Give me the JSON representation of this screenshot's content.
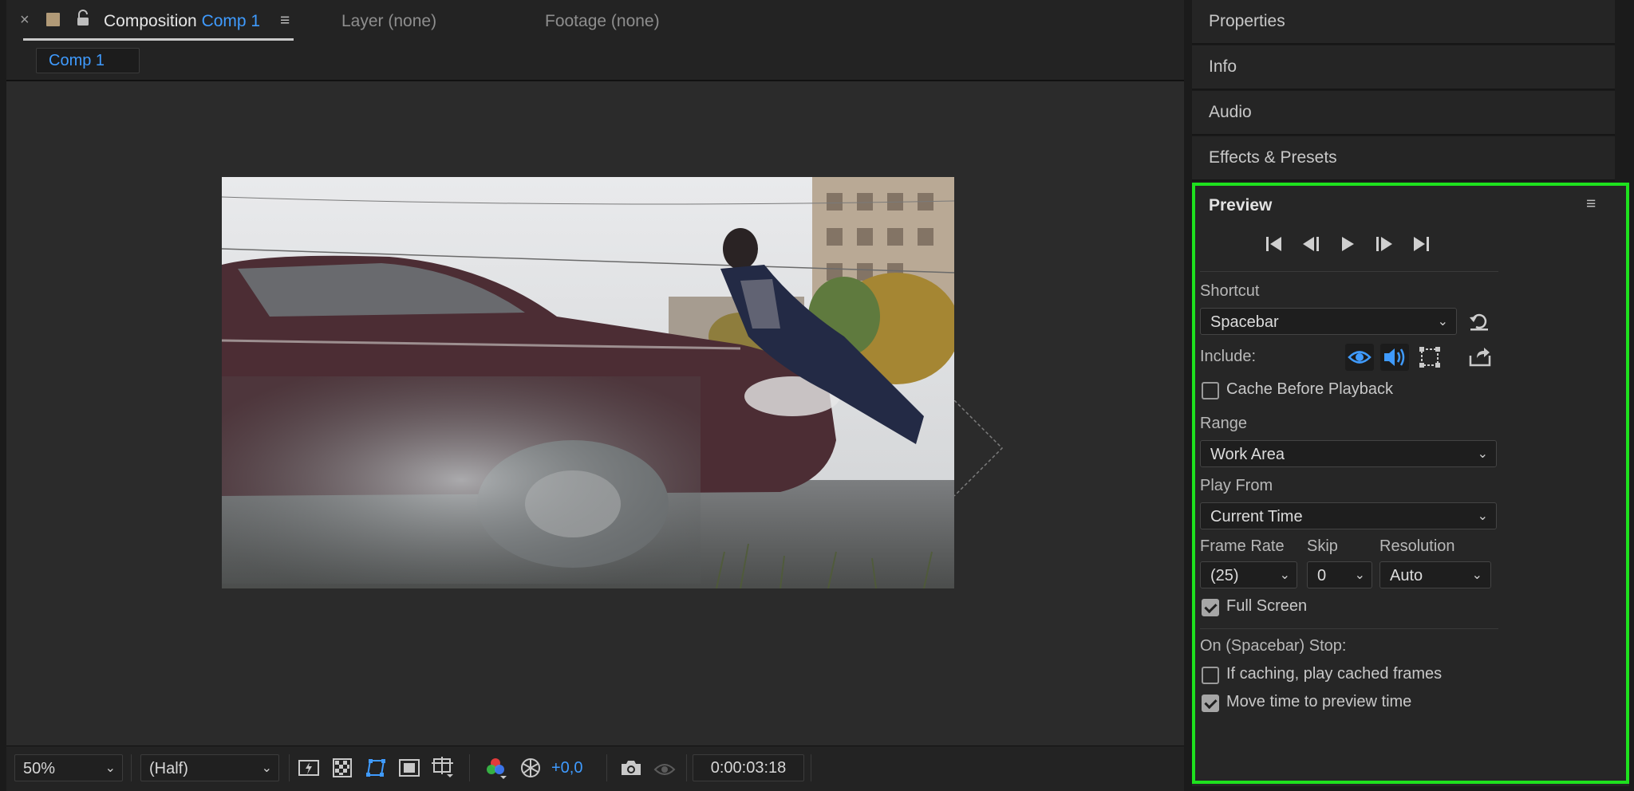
{
  "composition_tabs": {
    "active_prefix": "Composition",
    "active_name": "Comp 1",
    "layer_tab": "Layer (none)",
    "footage_tab": "Footage (none)",
    "comp_chip": "Comp 1"
  },
  "bottom_toolbar": {
    "zoom": "50%",
    "resolution": "(Half)",
    "exposure": "+0,0",
    "timecode": "0:00:03:18"
  },
  "right_panels": {
    "properties": "Properties",
    "info": "Info",
    "audio": "Audio",
    "effects_presets": "Effects & Presets"
  },
  "preview": {
    "title": "Preview",
    "shortcut_label": "Shortcut",
    "shortcut_value": "Spacebar",
    "include_label": "Include:",
    "cache_before_playback": "Cache Before Playback",
    "range_label": "Range",
    "range_value": "Work Area",
    "play_from_label": "Play From",
    "play_from_value": "Current Time",
    "frame_rate_label": "Frame Rate",
    "frame_rate_value": "(25)",
    "skip_label": "Skip",
    "skip_value": "0",
    "resolution_label": "Resolution",
    "resolution_value": "Auto",
    "full_screen": "Full Screen",
    "on_stop_label": "On (Spacebar) Stop:",
    "if_caching": "If caching, play cached frames",
    "move_time": "Move time to preview time",
    "cache_before_playback_checked": false,
    "full_screen_checked": true,
    "if_caching_checked": false,
    "move_time_checked": true
  },
  "colors": {
    "accent_blue": "#3f9bff",
    "highlight_outline": "#1ee11e",
    "panel_bg": "#262626"
  }
}
